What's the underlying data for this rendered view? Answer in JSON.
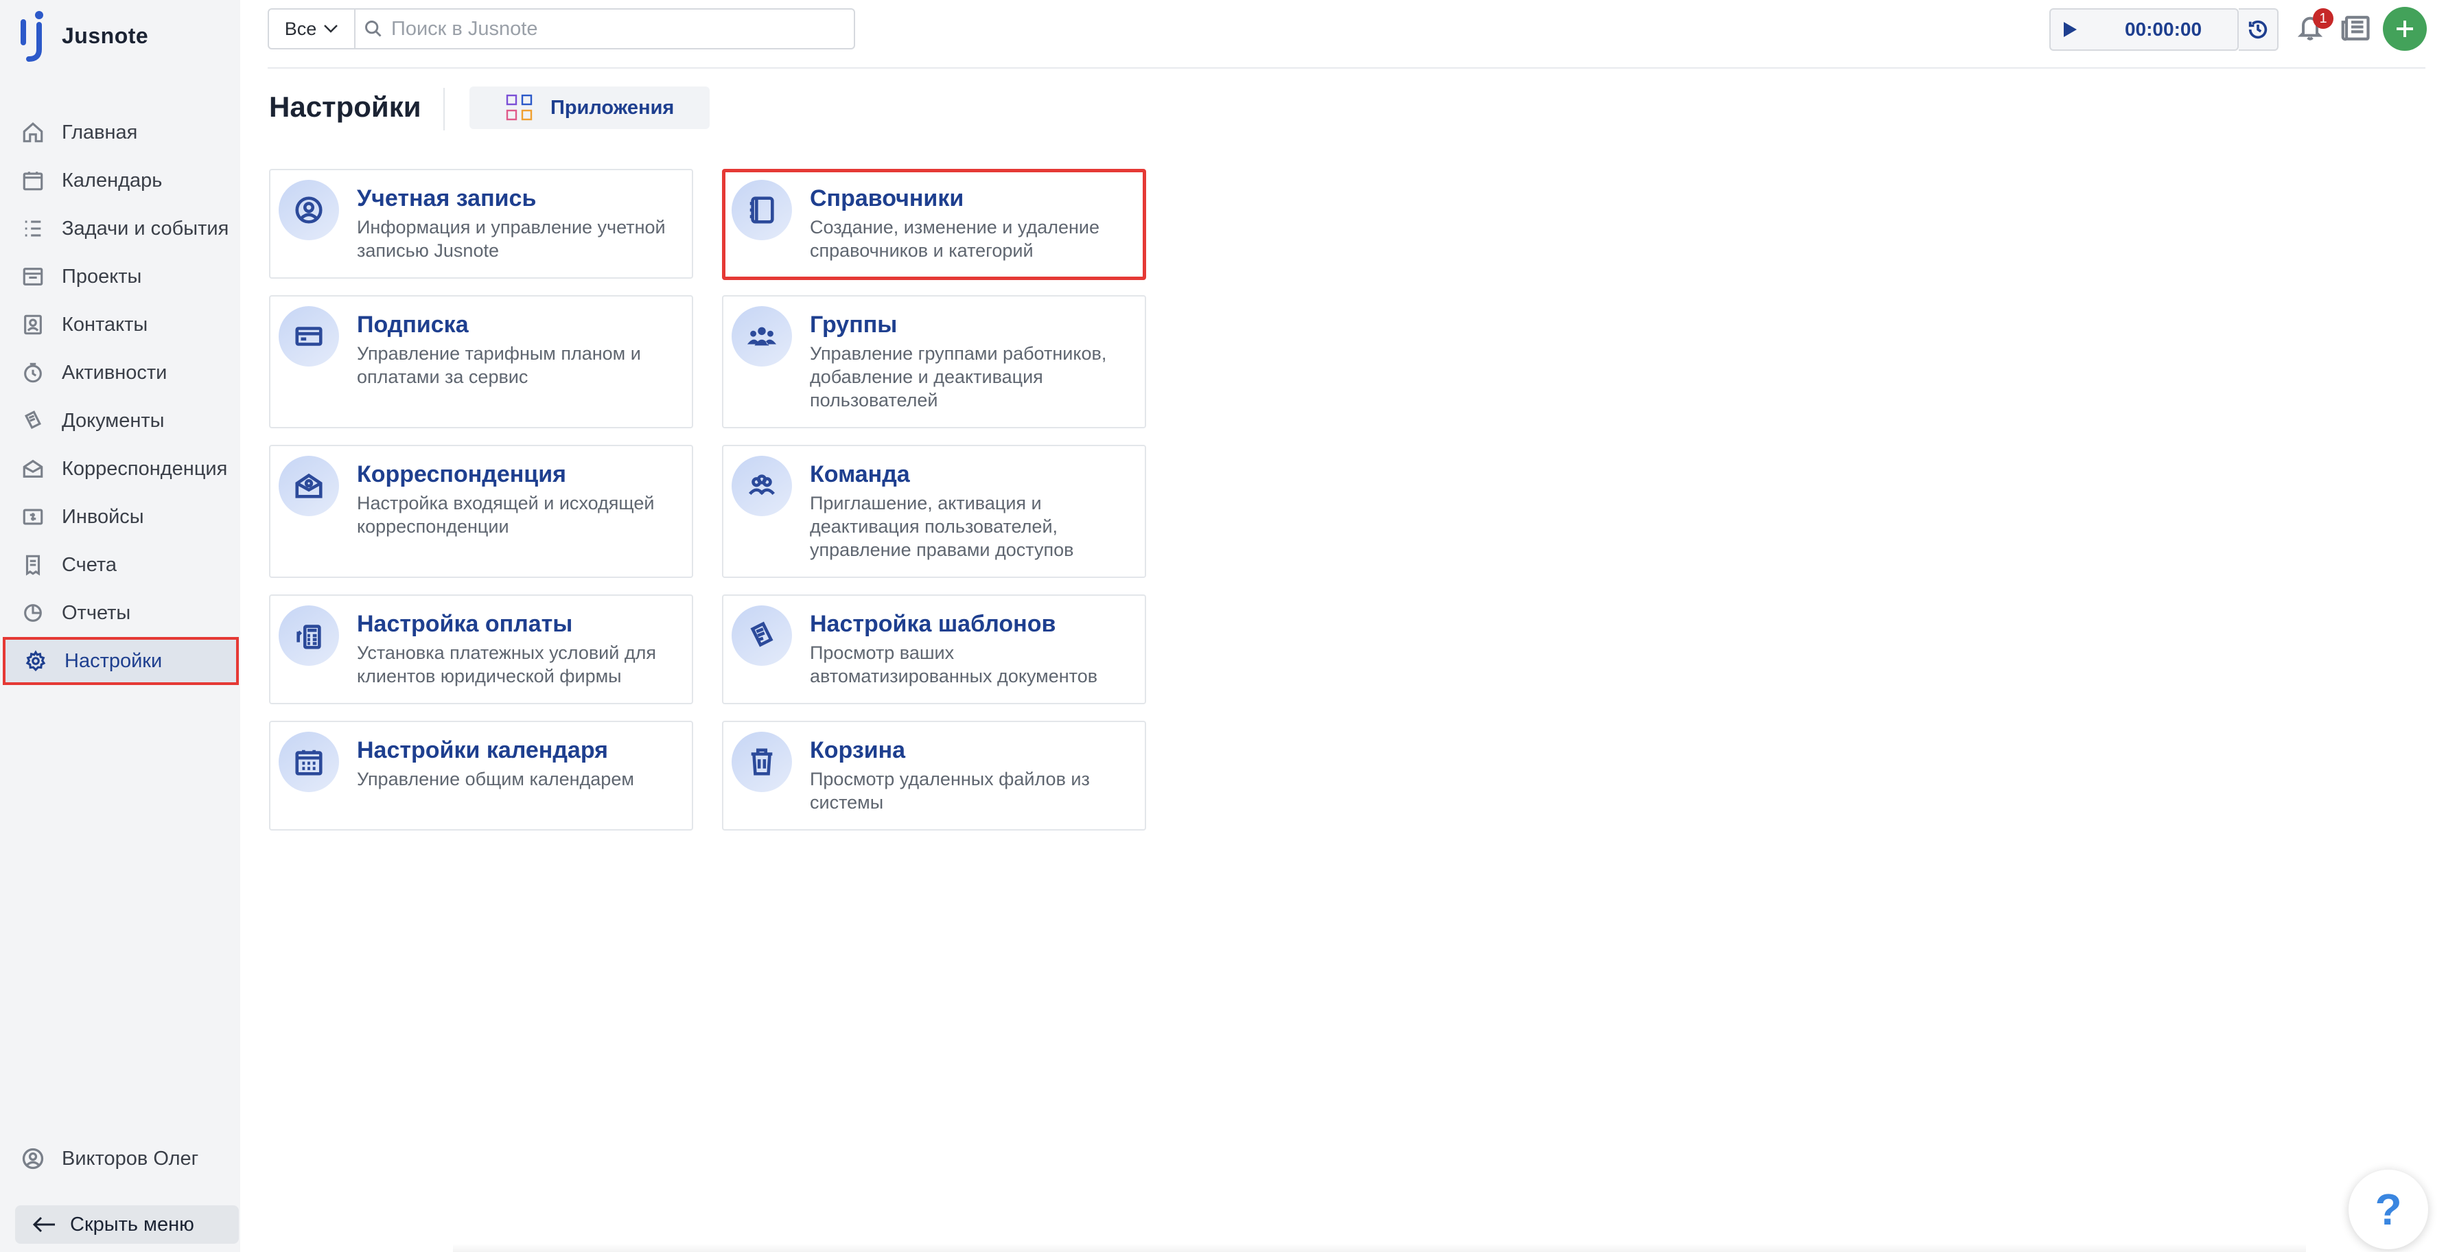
{
  "app": {
    "name": "Jusnote"
  },
  "sidebar": {
    "items": [
      {
        "label": "Главная",
        "icon": "home-icon"
      },
      {
        "label": "Календарь",
        "icon": "calendar-icon"
      },
      {
        "label": "Задачи и события",
        "icon": "tasks-icon"
      },
      {
        "label": "Проекты",
        "icon": "projects-icon"
      },
      {
        "label": "Контакты",
        "icon": "contacts-icon"
      },
      {
        "label": "Активности",
        "icon": "activities-icon"
      },
      {
        "label": "Документы",
        "icon": "documents-icon"
      },
      {
        "label": "Корреспонденция",
        "icon": "correspondence-icon"
      },
      {
        "label": "Инвойсы",
        "icon": "invoice-icon"
      },
      {
        "label": "Счета",
        "icon": "accounts-icon"
      },
      {
        "label": "Отчеты",
        "icon": "reports-icon"
      },
      {
        "label": "Настройки",
        "icon": "gear-icon",
        "active": true
      }
    ],
    "user_name": "Викторов Олег",
    "hide_menu_label": "Скрыть меню"
  },
  "topbar": {
    "scope_label": "Все",
    "search_placeholder": "Поиск в Jusnote",
    "timer_value": "00:00:00",
    "notifications_count": "1"
  },
  "page": {
    "title": "Настройки",
    "apps_button_label": "Приложения"
  },
  "cards": [
    {
      "id": "account",
      "title": "Учетная запись",
      "description": "Информация и управление учетной записью Jusnote",
      "icon": "user-circle-icon"
    },
    {
      "id": "directories",
      "title": "Справочники",
      "description": "Создание, изменение и удаление справочников и категорий",
      "icon": "notebook-icon",
      "highlighted": true
    },
    {
      "id": "subscription",
      "title": "Подписка",
      "description": "Управление тарифным планом и оплатами за сервис",
      "icon": "credit-card-icon"
    },
    {
      "id": "groups",
      "title": "Группы",
      "description": "Управление группами работников, добавление и деактивация пользователей",
      "icon": "group-icon"
    },
    {
      "id": "correspondence",
      "title": "Корреспонденция",
      "description": "Настройка входящей и исходящей корреспонденции",
      "icon": "mail-icon"
    },
    {
      "id": "team",
      "title": "Команда",
      "description": "Приглашение, активация и деактивация пользователей, управление правами доступов",
      "icon": "team-icon"
    },
    {
      "id": "payment-settings",
      "title": "Настройка оплаты",
      "description": "Установка платежных условий для клиентов юридической фирмы",
      "icon": "calculator-icon"
    },
    {
      "id": "templates",
      "title": "Настройка шаблонов",
      "description": "Просмотр ваших автоматизированных документов",
      "icon": "templates-icon"
    },
    {
      "id": "calendar-settings",
      "title": "Настройки календаря",
      "description": "Управление общим календарем",
      "icon": "calendar-icon"
    },
    {
      "id": "trash",
      "title": "Корзина",
      "description": "Просмотр удаленных файлов из системы",
      "icon": "trash-icon"
    }
  ],
  "help_label": "?",
  "colors": {
    "accent": "#1e3f8f",
    "highlight_border": "#e53935",
    "add_button": "#43a25a",
    "badge": "#c62828"
  }
}
